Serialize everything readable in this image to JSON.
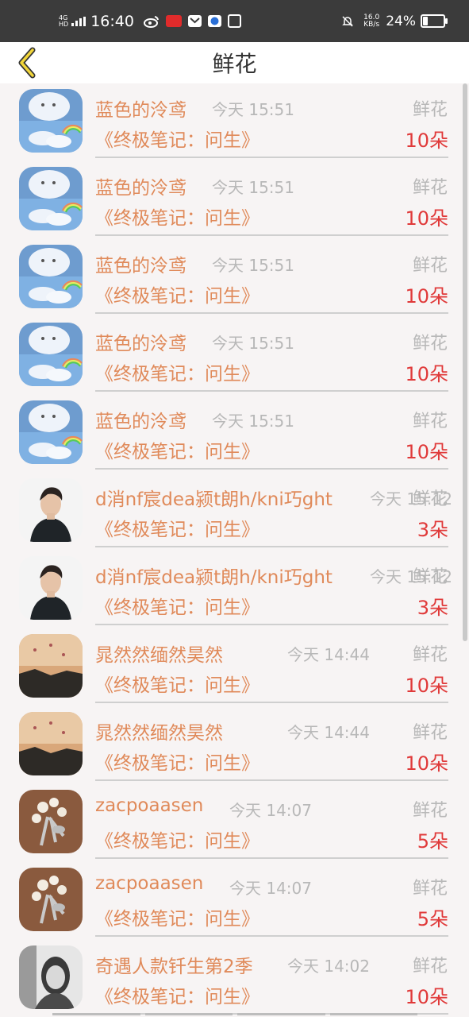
{
  "status_bar": {
    "network_top": "4G",
    "network_hd": "HD",
    "time": "16:40",
    "speed_value": "16.0",
    "speed_unit": "KB/s",
    "battery": "24%",
    "battery_level": 0.24
  },
  "header": {
    "title": "鲜花"
  },
  "rows": [
    {
      "name": "蓝色的泠鸢",
      "time": "今天 15:51",
      "gift": "鲜花",
      "book": "《终极笔记：问生》",
      "qty": "10朵",
      "avatar": "sky-cloud-avatar"
    },
    {
      "name": "蓝色的泠鸢",
      "time": "今天 15:51",
      "gift": "鲜花",
      "book": "《终极笔记：问生》",
      "qty": "10朵",
      "avatar": "sky-cloud-avatar"
    },
    {
      "name": "蓝色的泠鸢",
      "time": "今天 15:51",
      "gift": "鲜花",
      "book": "《终极笔记：问生》",
      "qty": "10朵",
      "avatar": "sky-cloud-avatar"
    },
    {
      "name": "蓝色的泠鸢",
      "time": "今天 15:51",
      "gift": "鲜花",
      "book": "《终极笔记：问生》",
      "qty": "10朵",
      "avatar": "sky-cloud-avatar"
    },
    {
      "name": "蓝色的泠鸢",
      "time": "今天 15:51",
      "gift": "鲜花",
      "book": "《终极笔记：问生》",
      "qty": "10朵",
      "avatar": "sky-cloud-avatar"
    },
    {
      "name": "d消nf宸dea颍t朗h/kni巧ght",
      "time": "今天 15:12",
      "gift": "鲜花",
      "book": "《终极笔记：问生》",
      "qty": "3朵",
      "avatar": "man-portrait-avatar"
    },
    {
      "name": "d消nf宸dea颍t朗h/kni巧ght",
      "time": "今天 15:12",
      "gift": "鲜花",
      "book": "《终极笔记：问生》",
      "qty": "3朵",
      "avatar": "man-portrait-avatar"
    },
    {
      "name": "晁然然缅然昊然",
      "time": "今天 14:44",
      "gift": "鲜花",
      "book": "《终极笔记：问生》",
      "qty": "10朵",
      "avatar": "sunset-avatar"
    },
    {
      "name": "晁然然缅然昊然",
      "time": "今天 14:44",
      "gift": "鲜花",
      "book": "《终极笔记：问生》",
      "qty": "10朵",
      "avatar": "sunset-avatar"
    },
    {
      "name": "zacpoaasen",
      "time": "今天 14:07",
      "gift": "鲜花",
      "book": "《终极笔记：问生》",
      "qty": "5朵",
      "avatar": "pearl-brooch-avatar"
    },
    {
      "name": "zacpoaasen",
      "time": "今天 14:07",
      "gift": "鲜花",
      "book": "《终极笔记：问生》",
      "qty": "5朵",
      "avatar": "pearl-brooch-avatar"
    },
    {
      "name": "奇遇人款钎生第2季",
      "time": "今天 14:02",
      "gift": "鲜花",
      "book": "《终极笔记：问生》",
      "qty": "10朵",
      "avatar": "girl-bw-avatar"
    }
  ]
}
